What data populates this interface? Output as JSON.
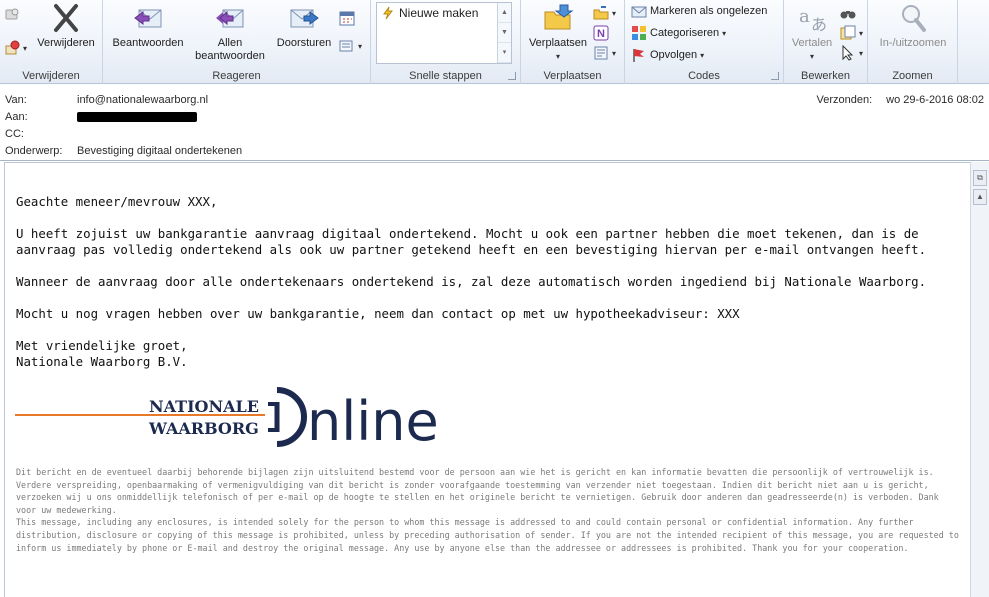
{
  "ribbon": {
    "delete_group": {
      "delete_label": "Verwijderen",
      "group_label": "Verwijderen"
    },
    "respond_group": {
      "reply_label": "Beantwoorden",
      "reply_all_label_1": "Allen",
      "reply_all_label_2": "beantwoorden",
      "forward_label": "Doorsturen",
      "group_label": "Reageren"
    },
    "quick_steps": {
      "item_label": "Nieuwe maken",
      "group_label": "Snelle stappen"
    },
    "move_group": {
      "move_label": "Verplaatsen",
      "group_label": "Verplaatsen"
    },
    "tags_group": {
      "mark_unread_label": "Markeren als ongelezen",
      "categorize_label": "Categoriseren",
      "follow_up_label": "Opvolgen",
      "group_label": "Codes"
    },
    "editing_group": {
      "translate_label": "Vertalen",
      "group_label": "Bewerken"
    },
    "zoom_group": {
      "zoom_label": "In-/uitzoomen",
      "group_label": "Zoomen"
    }
  },
  "header": {
    "from_label": "Van:",
    "from_value": "info@nationalewaarborg.nl",
    "to_label": "Aan:",
    "cc_label": "CC:",
    "subject_label": "Onderwerp:",
    "subject_value": "Bevestiging digitaal ondertekenen",
    "sent_label": "Verzonden:",
    "sent_value": "wo 29-6-2016 08:02"
  },
  "message": {
    "greeting": "Geachte meneer/mevrouw XXX,",
    "paragraph1": "U heeft zojuist uw bankgarantie aanvraag digitaal ondertekend. Mocht u ook een partner hebben die moet tekenen, dan is de aanvraag pas volledig ondertekend als ook uw partner getekend heeft en een bevestiging hiervan per e-mail ontvangen heeft.",
    "paragraph2": "Wanneer de aanvraag door alle ondertekenaars ondertekend is, zal deze automatisch worden ingediend bij Nationale Waarborg.",
    "paragraph3": "Mocht u nog vragen hebben over uw bankgarantie, neem dan contact op met uw hypotheekadviseur: XXX",
    "closing": "Met vriendelijke groet,",
    "signature": "Nationale Waarborg B.V.",
    "logo_line1": "NATIONALE",
    "logo_line2": "WAARBORG",
    "logo_word": "nline",
    "disclaimer_nl": "Dit bericht en de eventueel daarbij behorende bijlagen zijn uitsluitend bestemd voor de persoon aan wie het is gericht en kan informatie bevatten die persoonlijk of vertrouwelijk is. Verdere verspreiding, openbaarmaking of vermenigvuldiging van dit bericht is zonder voorafgaande toestemming van verzender niet toegestaan. Indien dit bericht niet aan u is gericht, verzoeken wij u ons onmiddellijk telefonisch of per e-mail op de hoogte te stellen en het originele bericht te vernietigen. Gebruik door anderen dan geadresseerde(n) is verboden. Dank voor uw medewerking.",
    "disclaimer_en": "This message, including any enclosures, is intended solely for the person to whom this message is addressed to and could contain personal or confidential information. Any further distribution, disclosure or copying of this message is prohibited, unless by preceding authorisation of sender. If you are not the intended recipient of this message, you are requested to inform us immediately by phone or E-mail and destroy the original message. Any use by anyone else than the addressee or addressees is prohibited. Thank you for your cooperation."
  },
  "colors": {
    "logo_navy": "#1b2a4e",
    "logo_orange": "#e8782a",
    "ribbon_border": "#b6c4d8"
  }
}
